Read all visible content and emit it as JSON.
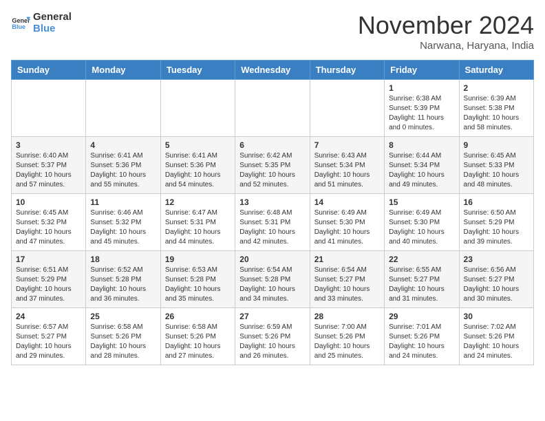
{
  "header": {
    "logo_line1": "General",
    "logo_line2": "Blue",
    "month": "November 2024",
    "location": "Narwana, Haryana, India"
  },
  "weekdays": [
    "Sunday",
    "Monday",
    "Tuesday",
    "Wednesday",
    "Thursday",
    "Friday",
    "Saturday"
  ],
  "weeks": [
    [
      {
        "day": "",
        "info": ""
      },
      {
        "day": "",
        "info": ""
      },
      {
        "day": "",
        "info": ""
      },
      {
        "day": "",
        "info": ""
      },
      {
        "day": "",
        "info": ""
      },
      {
        "day": "1",
        "info": "Sunrise: 6:38 AM\nSunset: 5:39 PM\nDaylight: 11 hours\nand 0 minutes."
      },
      {
        "day": "2",
        "info": "Sunrise: 6:39 AM\nSunset: 5:38 PM\nDaylight: 10 hours\nand 58 minutes."
      }
    ],
    [
      {
        "day": "3",
        "info": "Sunrise: 6:40 AM\nSunset: 5:37 PM\nDaylight: 10 hours\nand 57 minutes."
      },
      {
        "day": "4",
        "info": "Sunrise: 6:41 AM\nSunset: 5:36 PM\nDaylight: 10 hours\nand 55 minutes."
      },
      {
        "day": "5",
        "info": "Sunrise: 6:41 AM\nSunset: 5:36 PM\nDaylight: 10 hours\nand 54 minutes."
      },
      {
        "day": "6",
        "info": "Sunrise: 6:42 AM\nSunset: 5:35 PM\nDaylight: 10 hours\nand 52 minutes."
      },
      {
        "day": "7",
        "info": "Sunrise: 6:43 AM\nSunset: 5:34 PM\nDaylight: 10 hours\nand 51 minutes."
      },
      {
        "day": "8",
        "info": "Sunrise: 6:44 AM\nSunset: 5:34 PM\nDaylight: 10 hours\nand 49 minutes."
      },
      {
        "day": "9",
        "info": "Sunrise: 6:45 AM\nSunset: 5:33 PM\nDaylight: 10 hours\nand 48 minutes."
      }
    ],
    [
      {
        "day": "10",
        "info": "Sunrise: 6:45 AM\nSunset: 5:32 PM\nDaylight: 10 hours\nand 47 minutes."
      },
      {
        "day": "11",
        "info": "Sunrise: 6:46 AM\nSunset: 5:32 PM\nDaylight: 10 hours\nand 45 minutes."
      },
      {
        "day": "12",
        "info": "Sunrise: 6:47 AM\nSunset: 5:31 PM\nDaylight: 10 hours\nand 44 minutes."
      },
      {
        "day": "13",
        "info": "Sunrise: 6:48 AM\nSunset: 5:31 PM\nDaylight: 10 hours\nand 42 minutes."
      },
      {
        "day": "14",
        "info": "Sunrise: 6:49 AM\nSunset: 5:30 PM\nDaylight: 10 hours\nand 41 minutes."
      },
      {
        "day": "15",
        "info": "Sunrise: 6:49 AM\nSunset: 5:30 PM\nDaylight: 10 hours\nand 40 minutes."
      },
      {
        "day": "16",
        "info": "Sunrise: 6:50 AM\nSunset: 5:29 PM\nDaylight: 10 hours\nand 39 minutes."
      }
    ],
    [
      {
        "day": "17",
        "info": "Sunrise: 6:51 AM\nSunset: 5:29 PM\nDaylight: 10 hours\nand 37 minutes."
      },
      {
        "day": "18",
        "info": "Sunrise: 6:52 AM\nSunset: 5:28 PM\nDaylight: 10 hours\nand 36 minutes."
      },
      {
        "day": "19",
        "info": "Sunrise: 6:53 AM\nSunset: 5:28 PM\nDaylight: 10 hours\nand 35 minutes."
      },
      {
        "day": "20",
        "info": "Sunrise: 6:54 AM\nSunset: 5:28 PM\nDaylight: 10 hours\nand 34 minutes."
      },
      {
        "day": "21",
        "info": "Sunrise: 6:54 AM\nSunset: 5:27 PM\nDaylight: 10 hours\nand 33 minutes."
      },
      {
        "day": "22",
        "info": "Sunrise: 6:55 AM\nSunset: 5:27 PM\nDaylight: 10 hours\nand 31 minutes."
      },
      {
        "day": "23",
        "info": "Sunrise: 6:56 AM\nSunset: 5:27 PM\nDaylight: 10 hours\nand 30 minutes."
      }
    ],
    [
      {
        "day": "24",
        "info": "Sunrise: 6:57 AM\nSunset: 5:27 PM\nDaylight: 10 hours\nand 29 minutes."
      },
      {
        "day": "25",
        "info": "Sunrise: 6:58 AM\nSunset: 5:26 PM\nDaylight: 10 hours\nand 28 minutes."
      },
      {
        "day": "26",
        "info": "Sunrise: 6:58 AM\nSunset: 5:26 PM\nDaylight: 10 hours\nand 27 minutes."
      },
      {
        "day": "27",
        "info": "Sunrise: 6:59 AM\nSunset: 5:26 PM\nDaylight: 10 hours\nand 26 minutes."
      },
      {
        "day": "28",
        "info": "Sunrise: 7:00 AM\nSunset: 5:26 PM\nDaylight: 10 hours\nand 25 minutes."
      },
      {
        "day": "29",
        "info": "Sunrise: 7:01 AM\nSunset: 5:26 PM\nDaylight: 10 hours\nand 24 minutes."
      },
      {
        "day": "30",
        "info": "Sunrise: 7:02 AM\nSunset: 5:26 PM\nDaylight: 10 hours\nand 24 minutes."
      }
    ]
  ]
}
